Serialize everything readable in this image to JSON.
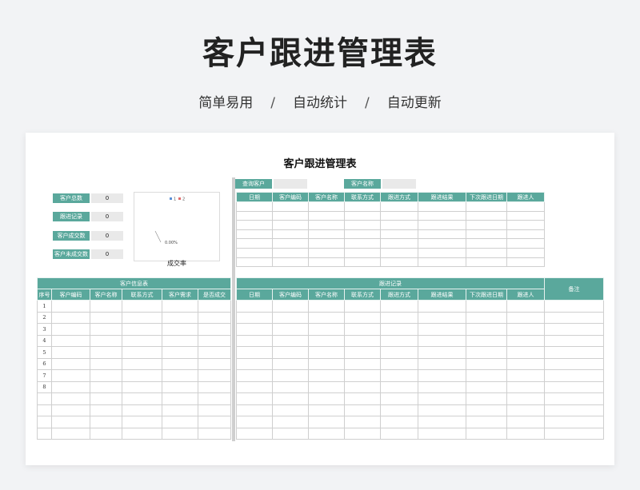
{
  "hero": {
    "title": "客户跟进管理表",
    "tags": [
      "简单易用",
      "自动统计",
      "自动更新"
    ],
    "separator": "/"
  },
  "sheet": {
    "title": "客户跟进管理表",
    "stats": [
      {
        "label": "客户总数",
        "value": "0"
      },
      {
        "label": "跟进记录",
        "value": "0"
      },
      {
        "label": "客户成交数",
        "value": "0"
      },
      {
        "label": "客户未成交数",
        "value": "0"
      }
    ],
    "chart": {
      "legend": [
        "1",
        "2"
      ],
      "data_label": "0.00%",
      "caption": "成交率"
    },
    "query": [
      {
        "label": "查询客户",
        "value": ""
      },
      {
        "label": "客户名称",
        "value": ""
      }
    ],
    "follow_headers": [
      "日期",
      "客户编码",
      "客户名称",
      "联系方式",
      "跟进方式",
      "跟进结果",
      "下次跟进日期",
      "跟进人"
    ],
    "customer_info": {
      "group_label": "客户信息表",
      "headers": [
        "序号",
        "客户编码",
        "客户名称",
        "联系方式",
        "客户需求",
        "是否成交"
      ],
      "row_numbers": [
        "1",
        "2",
        "3",
        "4",
        "5",
        "6",
        "7",
        "8",
        "",
        "",
        "",
        ""
      ]
    },
    "follow_record": {
      "group_label": "跟进记录",
      "headers": [
        "日期",
        "客户编码",
        "客户名称",
        "联系方式",
        "跟进方式",
        "跟进结果",
        "下次跟进日期",
        "跟进人"
      ],
      "remark": "备注"
    }
  },
  "colors": {
    "accent": "#5aa89c",
    "background": "#f2f3f5"
  }
}
